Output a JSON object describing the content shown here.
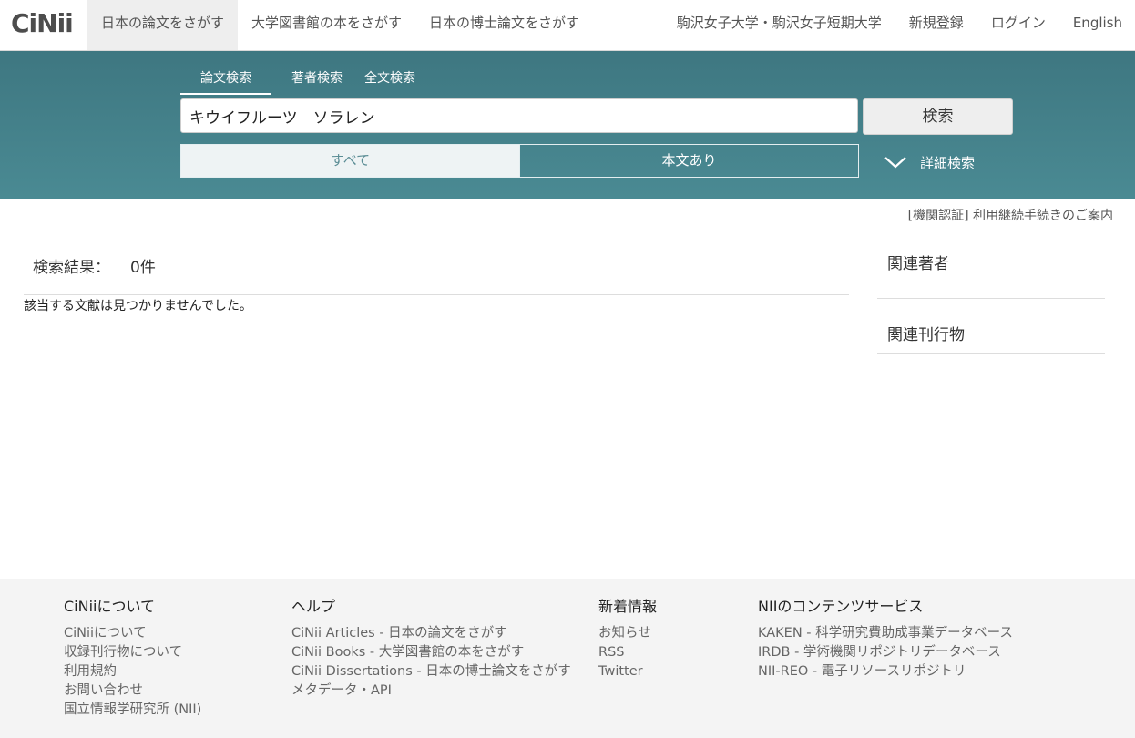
{
  "header": {
    "logo": "CiNii",
    "nav": [
      {
        "label": "日本の論文をさがす",
        "active": true
      },
      {
        "label": "大学図書館の本をさがす",
        "active": false
      },
      {
        "label": "日本の博士論文をさがす",
        "active": false
      }
    ],
    "institution": "駒沢女子大学・駒沢女子短期大学",
    "register": "新規登録",
    "login": "ログイン",
    "language": "English"
  },
  "search": {
    "tabs": [
      "論文検索",
      "著者検索",
      "全文検索"
    ],
    "query": "キウイフルーツ　ソラレン",
    "button": "検索",
    "filter_all": "すべて",
    "filter_fulltext": "本文あり",
    "advanced": "詳細検索"
  },
  "notice": "[機関認証] 利用継続手続きのご案内",
  "results": {
    "label": "検索結果：",
    "count": "0件",
    "empty_message": "該当する文献は見つかりませんでした。"
  },
  "sidebar": {
    "related_authors": "関連著者",
    "related_publications": "関連刊行物"
  },
  "footer": {
    "about": {
      "title": "CiNiiについて",
      "links": [
        "CiNiiについて",
        "収録刊行物について",
        "利用規約",
        "お問い合わせ",
        "国立情報学研究所 (NII)"
      ]
    },
    "help": {
      "title": "ヘルプ",
      "links": [
        "CiNii Articles - 日本の論文をさがす",
        "CiNii Books - 大学図書館の本をさがす",
        "CiNii Dissertations - 日本の博士論文をさがす",
        "メタデータ・API"
      ]
    },
    "news": {
      "title": "新着情報",
      "links": [
        "お知らせ",
        "RSS",
        "Twitter"
      ]
    },
    "nii": {
      "title": "NIIのコンテンツサービス",
      "links": [
        "KAKEN - 科学研究費助成事業データベース",
        "IRDB - 学術機関リポジトリデータベース",
        "NII-REO - 電子リソースリポジトリ"
      ]
    }
  }
}
